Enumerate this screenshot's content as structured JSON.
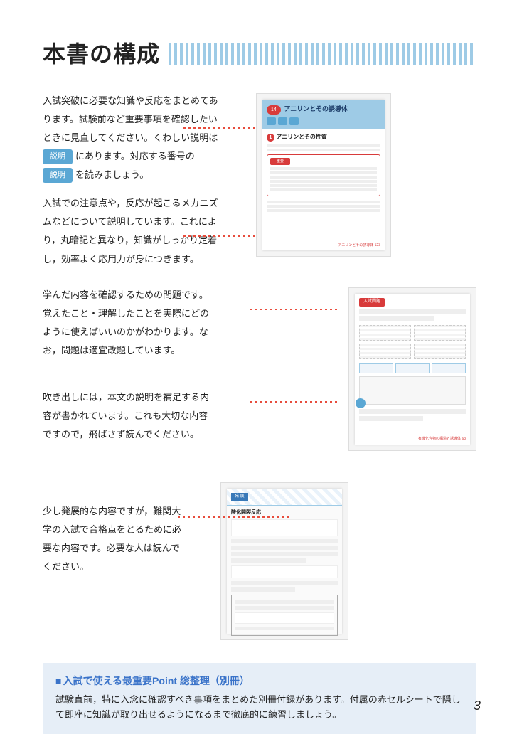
{
  "header": {
    "title": "本書の構成"
  },
  "sections": {
    "s1": {
      "thumb_banner_number": "14",
      "thumb_banner_title": "アニリンとその誘導体",
      "thumb_circle_number": "1",
      "thumb_section_title": "アニリンとその性質",
      "thumb_footer": "アニリンとその誘導体  123",
      "desc1_line1": "入試突破に必要な知識や反応をまとめてあ",
      "desc1_line2": "ります。試験前など重要事項を確認したい",
      "desc1_line3": "ときに見直してください。くわしい説明は",
      "badge1": "説明",
      "desc1_line4_after": "にあります。対応する番号の",
      "badge2": "説明",
      "desc1_line5_after": "を読みましょう。",
      "desc2_line1": "入試での注意点や，反応が起こるメカニズ",
      "desc2_line2": "ムなどについて説明しています。これによ",
      "desc2_line3": "り，丸暗記と異なり，知識がしっかり定着",
      "desc2_line4": "し，効率よく応用力が身につきます。"
    },
    "s2": {
      "line1": "学んだ内容を確認するための問題です。",
      "line2": "覚えたこと・理解したことを実際にどの",
      "line3": "ように使えばいいのかがわかります。な",
      "line4": "お，問題は適宜改題しています。",
      "thumb_tag": "入試問題",
      "thumb_footer": "有機化合物の構造と誘導体  63"
    },
    "s3": {
      "line1": "吹き出しには，本文の説明を補足する内",
      "line2": "容が書かれています。これも大切な内容",
      "line3": "ですので，飛ばさず読んでください。"
    },
    "s4": {
      "thumb_label": "発 展",
      "thumb_title": "酸化開裂反応",
      "line1": "少し発展的な内容ですが，難関大",
      "line2": "学の入試で合格点をとるために必",
      "line3": "要な内容です。必要な人は読んで",
      "line4": "ください。"
    }
  },
  "callout": {
    "title": "入試で使える最重要Point 総整理（別冊）",
    "body": "試験直前，特に入念に確認すべき事項をまとめた別冊付録があります。付属の赤セルシートで隠して即座に知識が取り出せるようになるまで徹底的に練習しましょう。"
  },
  "page_number": "3"
}
